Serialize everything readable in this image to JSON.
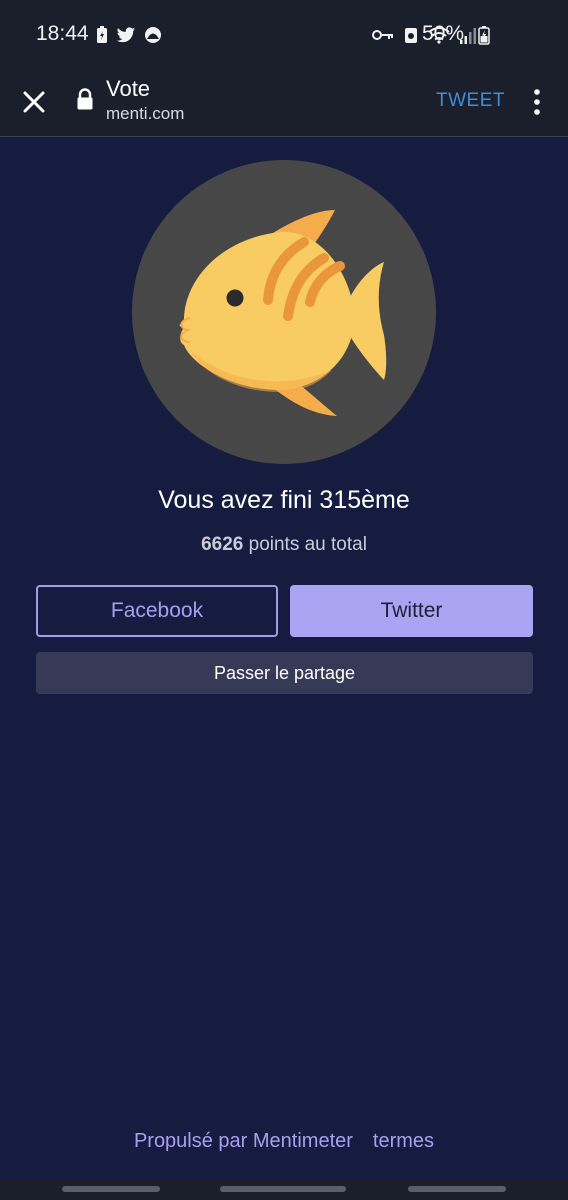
{
  "status_bar": {
    "time": "18:44",
    "battery": "50%",
    "icons_left": [
      "battery-saver-icon",
      "twitter-icon",
      "app-icon"
    ],
    "icons_right": [
      "key-icon",
      "alarm-icon",
      "wifi-icon",
      "signal-icon"
    ]
  },
  "app_bar": {
    "title": "Vote",
    "url": "menti.com",
    "action_label": "TWEET"
  },
  "result": {
    "rank_text": "Vous avez fini 315ème",
    "points_value": "6626",
    "points_suffix": "points au total"
  },
  "buttons": {
    "facebook": "Facebook",
    "twitter": "Twitter",
    "skip": "Passer le partage"
  },
  "footer": {
    "powered_by": "Propulsé par Mentimeter",
    "terms": "termes"
  },
  "colors": {
    "background": "#161c3f",
    "accent": "#aaa5f2",
    "link": "#3d8fd8"
  }
}
